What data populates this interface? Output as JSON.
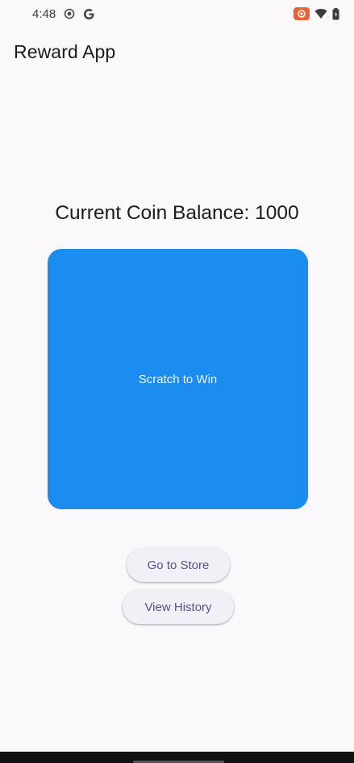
{
  "status_bar": {
    "time": "4:48",
    "icons_left": [
      "radio-icon",
      "google-icon"
    ],
    "icons_right": [
      "cast-icon",
      "wifi-icon",
      "battery-icon"
    ],
    "accent_record": "#e8623a"
  },
  "app_bar": {
    "title": "Reward App"
  },
  "main": {
    "balance_text": "Current Coin Balance: 1000",
    "scratch_card": {
      "label": "Scratch to Win",
      "color": "#1b8cf0"
    },
    "buttons": {
      "store_label": "Go to Store",
      "history_label": "View History"
    }
  }
}
